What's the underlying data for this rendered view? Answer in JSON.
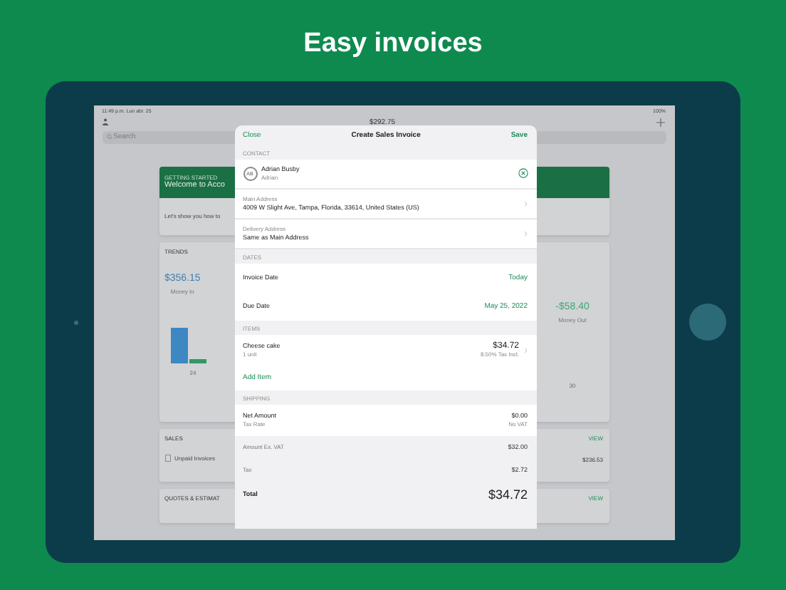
{
  "headline": "Easy invoices",
  "status_bar": {
    "time": "11:49 p.m.",
    "date": "Lun abr. 25",
    "battery": "100%"
  },
  "nav": {
    "title": "$292.75"
  },
  "search": {
    "placeholder": "Search"
  },
  "welcome": {
    "eyebrow": "GETTING STARTED",
    "title": "Welcome to Acco",
    "text": "Let's show you how to"
  },
  "trends": {
    "title": "TRENDS",
    "money_in": "$356.15",
    "money_in_label": "Money In",
    "money_out": "-$58.40",
    "money_out_label": "Money Out",
    "left_axis_label": "24",
    "right_axis_label": "30"
  },
  "sales": {
    "title": "SALES",
    "row_label": "Unpaid Invoices",
    "row_value": "$236.53",
    "action": "VIEW"
  },
  "quotes": {
    "title": "QUOTES & ESTIMAT",
    "action": "VIEW"
  },
  "modal": {
    "close": "Close",
    "title": "Create Sales Invoice",
    "save": "Save",
    "sections": [
      {
        "header": "CONTACT",
        "rows": [
          {
            "kind": "contact",
            "initials": "AB",
            "name": "Adrian Busby",
            "sub": "Adrian"
          },
          {
            "kind": "address",
            "label": "Main Address",
            "value": "4009 W Slight Ave, Tampa, Florida, 33614, United States (US)"
          },
          {
            "kind": "address",
            "label": "Delivery Address",
            "value": "Same as Main Address"
          }
        ]
      },
      {
        "header": "DATES",
        "rows": [
          {
            "kind": "date",
            "label": "Invoice Date",
            "value": "Today"
          },
          {
            "kind": "date",
            "label": "Due Date",
            "value": "May 25, 2022"
          }
        ]
      },
      {
        "header": "ITEMS",
        "rows": [
          {
            "kind": "item",
            "name": "Cheese cake",
            "qty": "1 unit",
            "price": "$34.72",
            "tax": "8.50% Tax Incl."
          },
          {
            "kind": "add",
            "label": "Add Item"
          }
        ]
      },
      {
        "header": "SHIPPING",
        "rows": [
          {
            "kind": "shipping",
            "label": "Net Amount",
            "value": "$0.00",
            "sub_label": "Tax Rate",
            "sub_value": "No VAT"
          }
        ]
      }
    ],
    "totals": [
      {
        "kind": "plain",
        "label": "Amount Ex. VAT",
        "value": "$32.00"
      },
      {
        "kind": "plain",
        "label": "Tax",
        "value": "$2.72"
      },
      {
        "kind": "total",
        "label": "Total",
        "value": "$34.72"
      }
    ]
  }
}
